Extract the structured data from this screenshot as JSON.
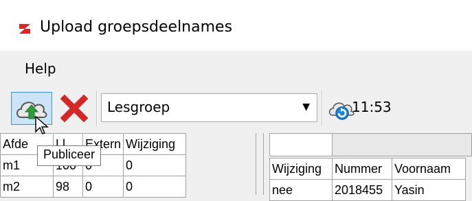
{
  "window": {
    "title": "Upload groepsdeelnames",
    "icon": "app-logo-icon"
  },
  "menu": {
    "items": [
      {
        "label": "Help"
      }
    ]
  },
  "toolbar": {
    "publish_icon": "cloud-upload-icon",
    "delete_icon": "delete-x-icon",
    "combo": {
      "value": "Lesgroep"
    },
    "refresh_icon": "cloud-refresh-icon",
    "time": "11:53"
  },
  "tooltip": {
    "text": "Publiceer"
  },
  "left_table": {
    "headers": [
      "Afde",
      "Ll",
      "Extern",
      "Wijziging"
    ],
    "rows": [
      [
        "m1",
        "100",
        "0",
        "0"
      ],
      [
        "m2",
        "98",
        "0",
        "0"
      ]
    ]
  },
  "right_table": {
    "headers": [
      "Wijziging",
      "Nummer",
      "Voornaam"
    ],
    "rows": [
      [
        "nee",
        "2018455",
        "Yasin"
      ]
    ]
  },
  "colors": {
    "button_hover": "#cce4f7",
    "button_border": "#3d8fd6",
    "delete_red": "#d42828"
  }
}
